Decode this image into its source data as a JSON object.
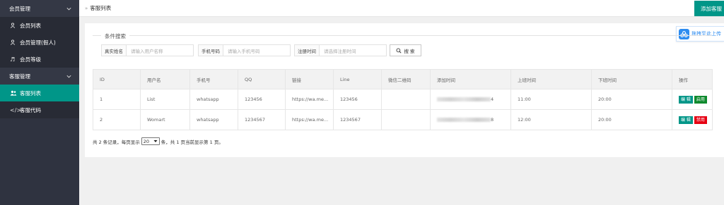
{
  "sidebar": {
    "groups": [
      {
        "label": "会员管理",
        "items": [
          {
            "label": "会员列表",
            "icon": "user-icon"
          },
          {
            "label": "会员管理(假人)",
            "icon": "user-icon"
          },
          {
            "label": "会员等级",
            "icon": "music-icon"
          }
        ]
      },
      {
        "label": "客服管理",
        "items": [
          {
            "label": "客服列表",
            "icon": "users-icon",
            "active": true
          },
          {
            "label": "客服代码",
            "icon": "code-icon"
          }
        ]
      }
    ]
  },
  "topbar": {
    "breadcrumb_sep": "»",
    "breadcrumb": "客服列表",
    "add_button": "添加客服"
  },
  "upload_badge": {
    "label": "拖拽至此上传"
  },
  "search": {
    "legend": "条件搜索",
    "name_label": "真实姓名",
    "name_placeholder": "请输入用户名称",
    "phone_label": "手机号码",
    "phone_placeholder": "请输入手机号码",
    "time_label": "注册时间",
    "time_placeholder": "请选择注册时间",
    "button": "搜 索"
  },
  "table": {
    "headers": [
      "ID",
      "用户名",
      "手机号",
      "QQ",
      "链接",
      "Line",
      "微信二维码",
      "添加时间",
      "上班时间",
      "下班时间",
      "操作"
    ],
    "rows": [
      {
        "id": "1",
        "username": "List",
        "phone": "whatsapp",
        "qq": "123456",
        "link": "https://wa.me...",
        "line": "123456",
        "wechat": "",
        "added_suffix": "4",
        "start": "11:00",
        "end": "20:00",
        "edit": "编 辑",
        "toggle": "启用",
        "toggle_state": "enable"
      },
      {
        "id": "2",
        "username": "Womart",
        "phone": "whatsapp",
        "qq": "1234567",
        "link": "https://wa.me...",
        "line": "1234567",
        "wechat": "",
        "added_suffix": "8",
        "start": "12:00",
        "end": "20:00",
        "edit": "编 辑",
        "toggle": "禁用",
        "toggle_state": "disable"
      }
    ]
  },
  "pager": {
    "prefix": "共 2 条记录，每页显示",
    "page_size": "20",
    "suffix": "条，共 1 页当前显示第 1 页。"
  },
  "colors": {
    "accent": "#009688",
    "sidebar": "#2f3340",
    "enable": "#0f8a2e",
    "disable": "#e60012",
    "upload": "#2d8cf0"
  }
}
